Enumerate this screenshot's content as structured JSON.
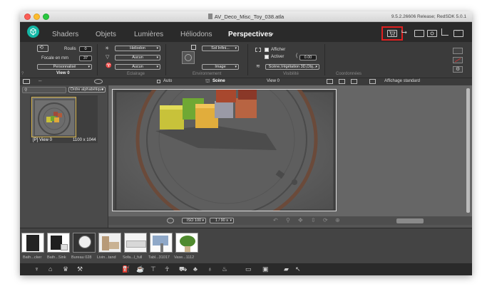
{
  "window": {
    "title": "AV_Deco_Misc_Toy_038.atla",
    "version": "9.5.2.26606 Release; RedSDK 5.0.1"
  },
  "nav": {
    "tabs": [
      "Shaders",
      "Objets",
      "Lumières",
      "Héliodons",
      "Perspectives"
    ],
    "active_tab": "Perspectives"
  },
  "camera": {
    "roll_label": "Roulis",
    "roll_value": "0",
    "focal_label": "Focale en mm",
    "focal_value": "37",
    "mode_value": "Personnalisé",
    "view_name": "View 0"
  },
  "lighting": {
    "heliodon_value": "Heliodon",
    "light1_value": "Aucun",
    "light2_value": "Aucun",
    "section_label": "Eclairage"
  },
  "environment": {
    "sky_value": "Sol Infini...",
    "image_value": "Image",
    "section_label": "Environnement"
  },
  "visibility": {
    "show_label": "Afficher",
    "activate_label": "Activer",
    "value": "0.00",
    "layer_value": "Scène,Végétation 3D,Obj...",
    "section_label": "Visibilité"
  },
  "coordinates": {
    "section_label": "Coordonnées"
  },
  "left_panel": {
    "sort_value": "Ordre alphabétique",
    "thumb_name": "[P] View 0",
    "thumb_size": "1100 x 1044"
  },
  "viewport": {
    "auto_label": "Auto",
    "scene_label": "Scène",
    "view_label": "View 0",
    "display_label": "Affichage standard",
    "iso_value": "ISO 100",
    "shutter_value": "1 / 90 s"
  },
  "library": {
    "items": [
      "Bath...cker",
      "Bath...Sink",
      "Bureau 028",
      "Livin...tand",
      "Sofa...l_full",
      "Tabl...31017",
      "Vase...1112"
    ]
  },
  "colors": {
    "accent": "#14b8a6",
    "highlight": "#e02020",
    "thumb_border": "#d4b24a"
  }
}
